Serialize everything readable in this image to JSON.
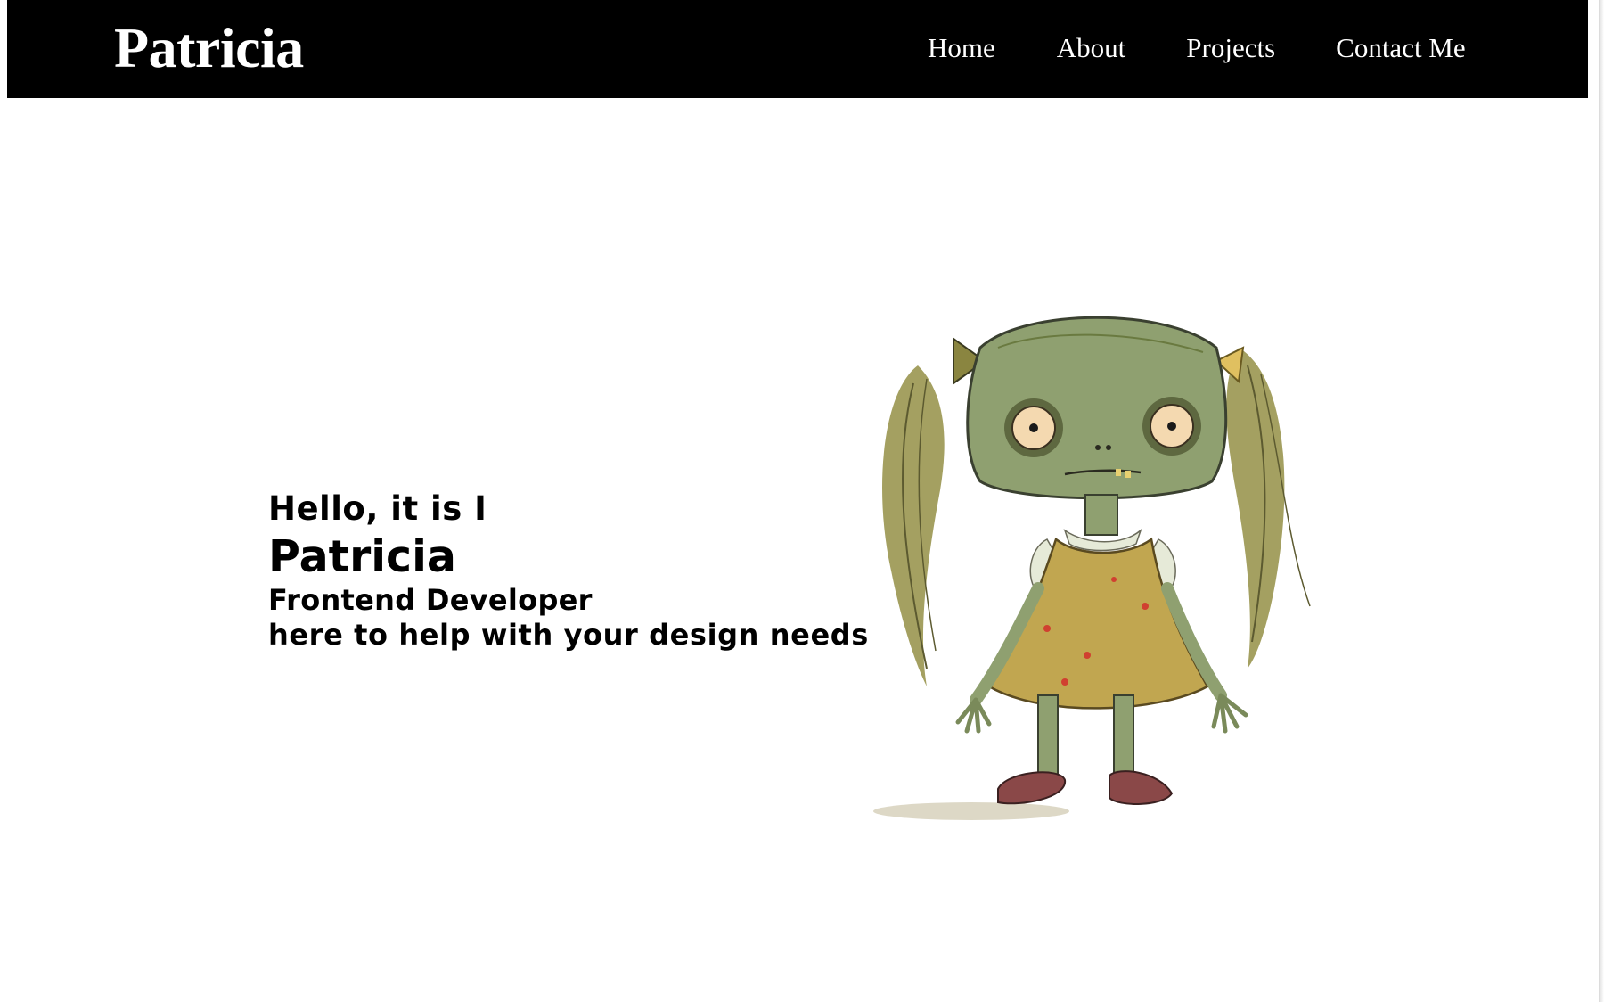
{
  "header": {
    "brand": "Patricia",
    "nav": [
      {
        "label": "Home"
      },
      {
        "label": "About"
      },
      {
        "label": "Projects"
      },
      {
        "label": "Contact Me"
      }
    ]
  },
  "hero": {
    "greeting": "Hello, it is I",
    "name": "Patricia",
    "role": "Frontend Developer",
    "tagline": "here to help with your design needs",
    "illustration_icon": "zombie-girl-illustration"
  },
  "colors": {
    "navbar_bg": "#000000",
    "nav_text": "#ffffff",
    "page_bg": "#ffffff",
    "hero_text": "#000000",
    "skin": "#8fa070",
    "hair": "#9a9650",
    "dress": "#c1a650"
  }
}
